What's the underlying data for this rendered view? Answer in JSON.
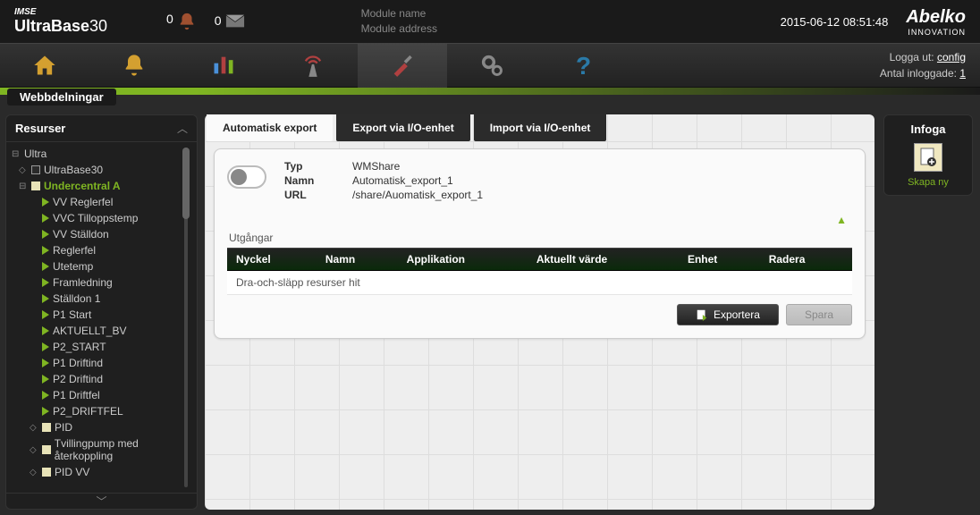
{
  "header": {
    "logo_prefix": "IMSE",
    "logo_main": "UltraBase",
    "logo_suffix": "30",
    "alerts_count": "0",
    "mail_count": "0",
    "module_name_label": "Module name",
    "module_address_label": "Module address",
    "datetime": "2015-06-12 08:51:48",
    "brand": "Abelko",
    "brand_sub": "INNOVATION"
  },
  "nav": {
    "logout_label": "Logga ut:",
    "logout_user": "config",
    "logged_in_label": "Antal inloggade:",
    "logged_in_count": "1"
  },
  "page_title": "Webbdelningar",
  "sidebar": {
    "title": "Resurser",
    "root": "Ultra",
    "level1": "UltraBase30",
    "selected": "Undercentral A",
    "items": [
      "VV Reglerfel",
      "VVC Tilloppstemp",
      "VV Ställdon",
      "Reglerfel",
      "Utetemp",
      "Framledning",
      "Ställdon 1",
      "P1 Start",
      "AKTUELLT_BV",
      "P2_START",
      "P1 Driftind",
      "P2 Driftind",
      "P1 Driftfel",
      "P2_DRIFTFEL"
    ],
    "sub1": "PID",
    "sub2": "Tvillingpump med återkoppling",
    "sub3": "PID VV"
  },
  "tabs": [
    "Automatisk export",
    "Export via I/O-enhet",
    "Import via I/O-enhet"
  ],
  "card": {
    "fields": {
      "typ_label": "Typ",
      "typ_value": "WMShare",
      "namn_label": "Namn",
      "namn_value": "Automatisk_export_1",
      "url_label": "URL",
      "url_value": "/share/Auomatisk_export_1"
    },
    "section_title": "Utgångar",
    "columns": [
      "Nyckel",
      "Namn",
      "Applikation",
      "Aktuellt värde",
      "Enhet",
      "Radera"
    ],
    "empty_row": "Dra-och-släpp resurser hit",
    "export_btn": "Exportera",
    "save_btn": "Spara"
  },
  "infoga": {
    "title": "Infoga",
    "caption": "Skapa ny"
  }
}
